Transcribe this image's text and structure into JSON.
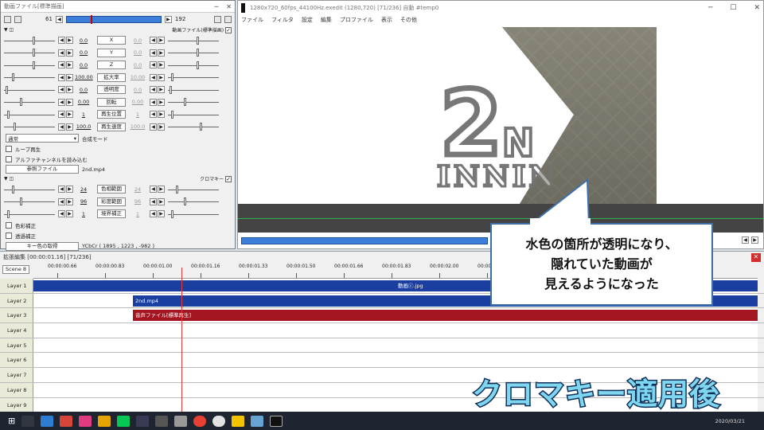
{
  "settings": {
    "title": "動画ファイル[標準描画]",
    "frame_start": "61",
    "frame_end": "192",
    "section1_label": "動画ファイル(標準描画)",
    "params": [
      {
        "value": "0.0",
        "label": "X",
        "value2": "0.0"
      },
      {
        "value": "0.0",
        "label": "Y",
        "value2": "0.0"
      },
      {
        "value": "0.0",
        "label": "Z",
        "value2": "0.0"
      },
      {
        "value": "100.00",
        "label": "拡大率",
        "value2": "10.00"
      },
      {
        "value": "0.0",
        "label": "透明度",
        "value2": "0.0"
      },
      {
        "value": "0.00",
        "label": "回転",
        "value2": "0.00"
      },
      {
        "value": "1",
        "label": "再生位置",
        "value2": "1"
      },
      {
        "value": "100.0",
        "label": "再生速度",
        "value2": "100.0"
      }
    ],
    "blend_mode_value": "通常",
    "blend_mode_label": "合成モード",
    "loop_label": "ループ再生",
    "alpha_label": "アルファチャンネルを読み込む",
    "ref_file_button": "参照ファイル",
    "file_name": "2nd.mp4",
    "section2_label": "クロマキー",
    "chroma_params": [
      {
        "value": "24",
        "label": "色相範囲",
        "value2": "24"
      },
      {
        "value": "96",
        "label": "彩度範囲",
        "value2": "96"
      },
      {
        "value": "1",
        "label": "境界補正",
        "value2": "1"
      }
    ],
    "color_correct_label": "色彩補正",
    "transparency_correct_label": "透過補正",
    "key_color_button": "キー色の取得",
    "key_color_value": "YCbCr ( 1895 , 1223 , -982 )"
  },
  "mainwin": {
    "title": "1280x720_60fps_44100Hz.exedit (1280,720) [71/236] 自動 #temp0",
    "menu": [
      "ファイル",
      "フィルタ",
      "設定",
      "編集",
      "プロファイル",
      "表示",
      "その他"
    ]
  },
  "preview": {
    "big_text": "2",
    "nd_text": "N",
    "inning_text": "INNIN"
  },
  "timeline": {
    "title": "拡張編集 [00:00:01.16] [71/236]",
    "scene": "Scene 8",
    "ticks": [
      "00:00:00.66",
      "00:00:00.83",
      "00:00:01.00",
      "00:00:01.16",
      "00:00:01.33",
      "00:00:01.50",
      "00:00:01.66",
      "00:00:01.83",
      "00:00:02.00",
      "00:00:02."
    ],
    "layers": [
      "Layer 1",
      "Layer 2",
      "Layer 3",
      "Layer 4",
      "Layer 5",
      "Layer 6",
      "Layer 7",
      "Layer 8",
      "Layer 9"
    ],
    "clips": [
      {
        "label": "動画ⓒ.jpg",
        "layer": 0,
        "color": "#1a3fa0"
      },
      {
        "label": "2nd.mp4",
        "layer": 1,
        "color": "#1a3fa0"
      },
      {
        "label": "音声ファイル[標準再生]",
        "layer": 2,
        "color": "#a31621"
      }
    ]
  },
  "callout": {
    "lines": [
      "水色の箇所が透明になり、",
      "隠れていた動画が",
      "見えるようになった"
    ]
  },
  "caption": "クロマキー適用後",
  "taskbar": {
    "time": "2020/03/21"
  }
}
